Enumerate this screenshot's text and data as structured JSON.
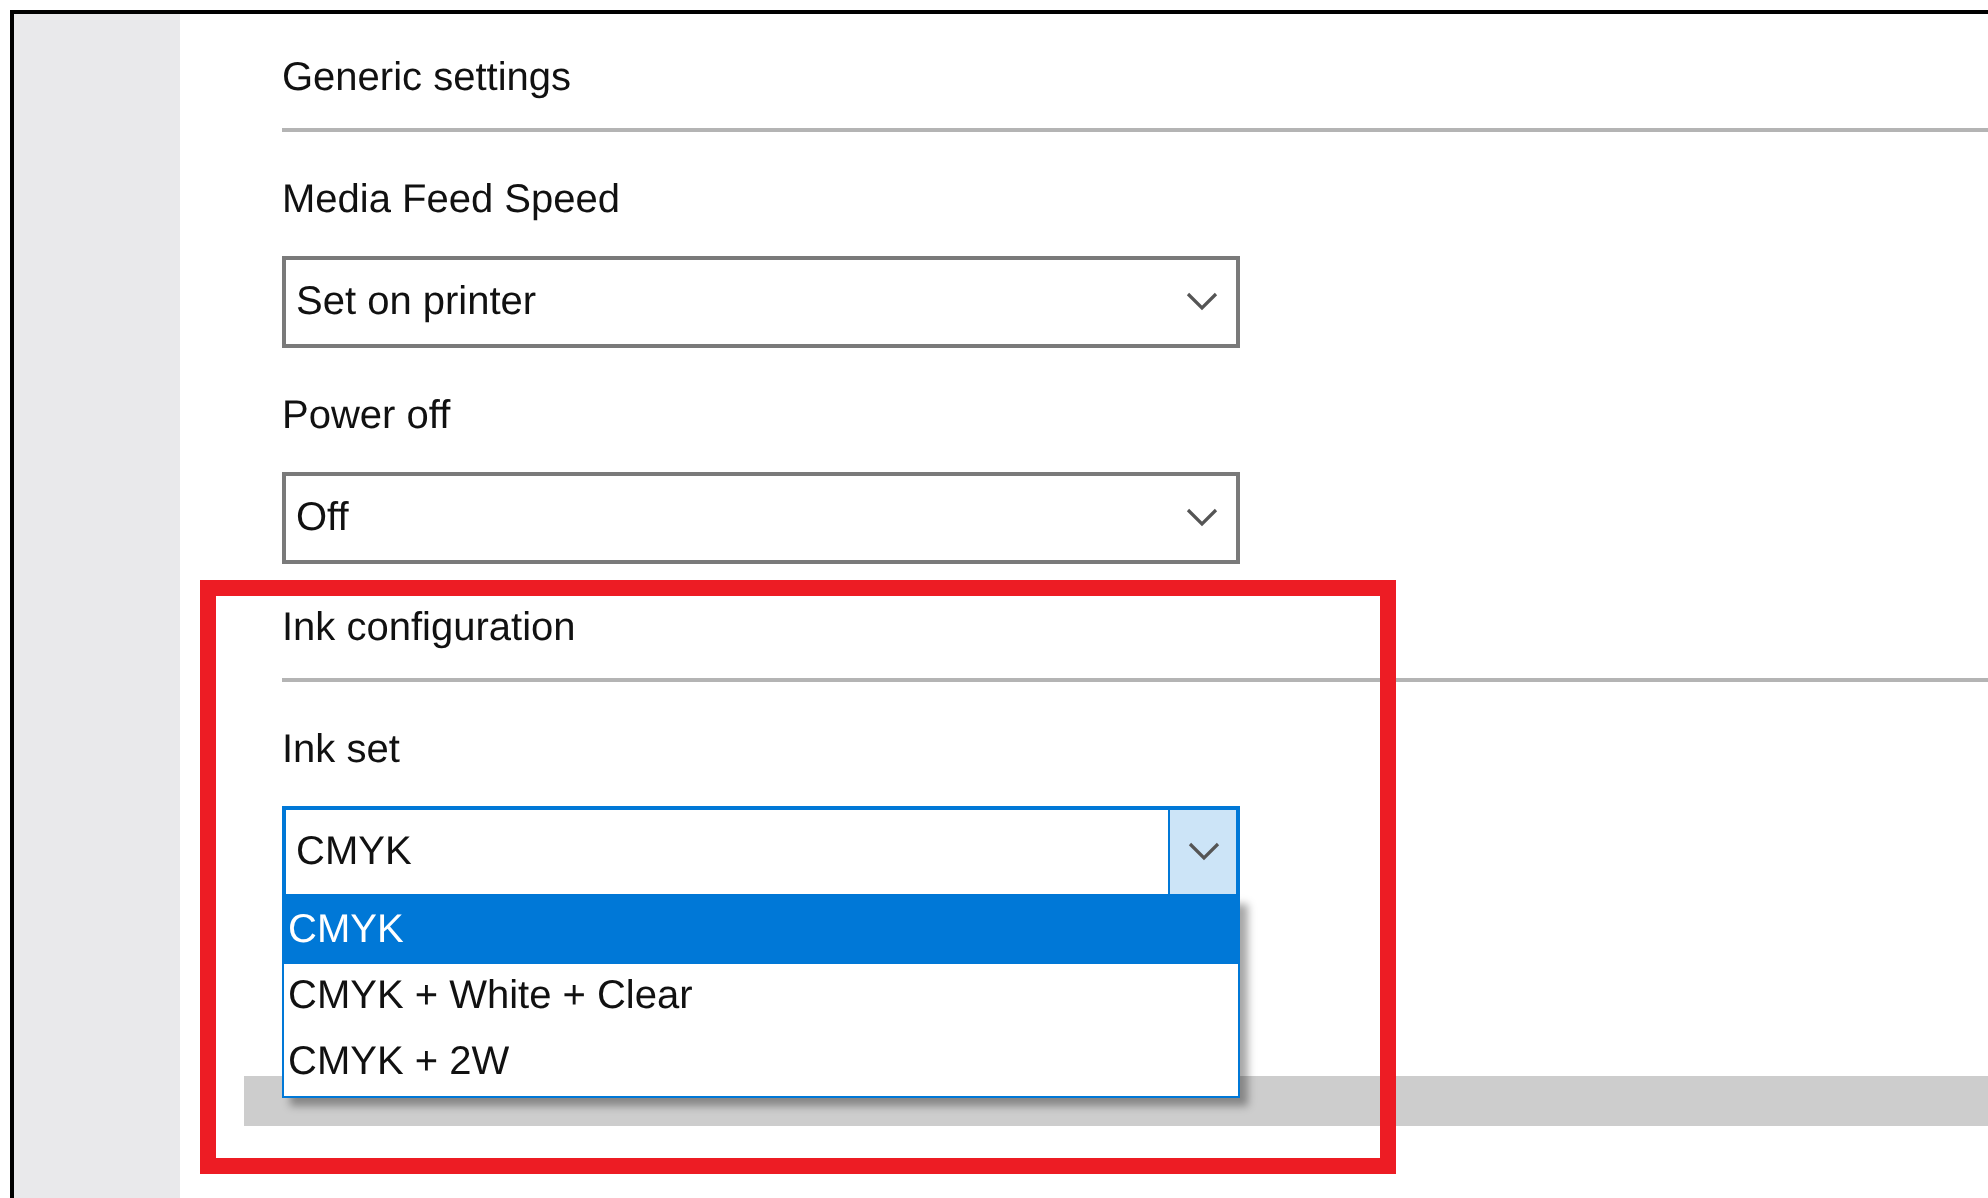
{
  "sections": [
    {
      "heading": "Generic settings",
      "fields": [
        {
          "label": "Media Feed Speed",
          "value": "Set on printer",
          "open": false
        },
        {
          "label": "Power off",
          "value": "Off",
          "open": false
        }
      ]
    },
    {
      "heading": "Ink configuration",
      "fields": [
        {
          "label": "Ink set",
          "value": "CMYK",
          "open": true,
          "options": [
            {
              "label": "CMYK",
              "selected": true
            },
            {
              "label": "CMYK + White + Clear",
              "selected": false
            },
            {
              "label": "CMYK + 2W",
              "selected": false
            }
          ]
        }
      ]
    }
  ]
}
